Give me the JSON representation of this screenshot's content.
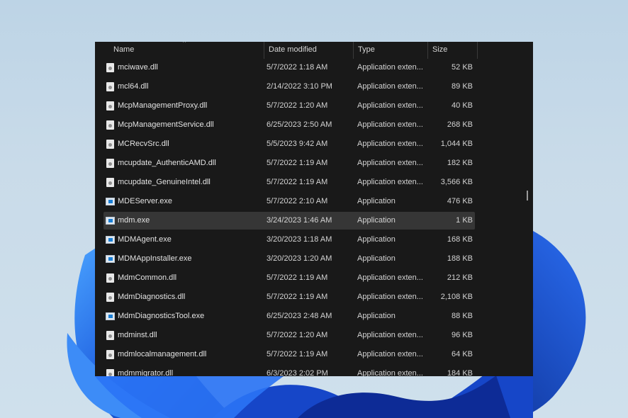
{
  "colors": {
    "window_bg": "#191919",
    "selected_row": "#363636",
    "text": "#e2e2e2",
    "wallpaper_blue": "#1f5fe0"
  },
  "header": {
    "columns": [
      {
        "label": "Name"
      },
      {
        "label": "Date modified"
      },
      {
        "label": "Type"
      },
      {
        "label": "Size"
      }
    ],
    "sort_indicator": "^"
  },
  "files": [
    {
      "name": "mciwave.dll",
      "date": "5/7/2022 1:18 AM",
      "type": "Application exten...",
      "size": "52 KB",
      "icon": "dll-file-icon"
    },
    {
      "name": "mcl64.dll",
      "date": "2/14/2022 3:10 PM",
      "type": "Application exten...",
      "size": "89 KB",
      "icon": "dll-file-icon"
    },
    {
      "name": "McpManagementProxy.dll",
      "date": "5/7/2022 1:20 AM",
      "type": "Application exten...",
      "size": "40 KB",
      "icon": "dll-file-icon"
    },
    {
      "name": "McpManagementService.dll",
      "date": "6/25/2023 2:50 AM",
      "type": "Application exten...",
      "size": "268 KB",
      "icon": "dll-file-icon"
    },
    {
      "name": "MCRecvSrc.dll",
      "date": "5/5/2023 9:42 AM",
      "type": "Application exten...",
      "size": "1,044 KB",
      "icon": "dll-file-icon"
    },
    {
      "name": "mcupdate_AuthenticAMD.dll",
      "date": "5/7/2022 1:19 AM",
      "type": "Application exten...",
      "size": "182 KB",
      "icon": "dll-file-icon"
    },
    {
      "name": "mcupdate_GenuineIntel.dll",
      "date": "5/7/2022 1:19 AM",
      "type": "Application exten...",
      "size": "3,566 KB",
      "icon": "dll-file-icon"
    },
    {
      "name": "MDEServer.exe",
      "date": "5/7/2022 2:10 AM",
      "type": "Application",
      "size": "476 KB",
      "icon": "exe-app-icon"
    },
    {
      "name": "mdm.exe",
      "date": "3/24/2023 1:46 AM",
      "type": "Application",
      "size": "1 KB",
      "icon": "exe-app-icon",
      "selected": true
    },
    {
      "name": "MDMAgent.exe",
      "date": "3/20/2023 1:18 AM",
      "type": "Application",
      "size": "168 KB",
      "icon": "exe-app-icon"
    },
    {
      "name": "MDMAppInstaller.exe",
      "date": "3/20/2023 1:20 AM",
      "type": "Application",
      "size": "188 KB",
      "icon": "exe-app-icon"
    },
    {
      "name": "MdmCommon.dll",
      "date": "5/7/2022 1:19 AM",
      "type": "Application exten...",
      "size": "212 KB",
      "icon": "dll-file-icon"
    },
    {
      "name": "MdmDiagnostics.dll",
      "date": "5/7/2022 1:19 AM",
      "type": "Application exten...",
      "size": "2,108 KB",
      "icon": "dll-file-icon"
    },
    {
      "name": "MdmDiagnosticsTool.exe",
      "date": "6/25/2023 2:48 AM",
      "type": "Application",
      "size": "88 KB",
      "icon": "exe-app-icon"
    },
    {
      "name": "mdminst.dll",
      "date": "5/7/2022 1:20 AM",
      "type": "Application exten...",
      "size": "96 KB",
      "icon": "dll-file-icon"
    },
    {
      "name": "mdmlocalmanagement.dll",
      "date": "5/7/2022 1:19 AM",
      "type": "Application exten...",
      "size": "64 KB",
      "icon": "dll-file-icon"
    },
    {
      "name": "mdmmigrator.dll",
      "date": "6/3/2023 2:02 PM",
      "type": "Application exten...",
      "size": "184 KB",
      "icon": "dll-file-icon"
    }
  ]
}
